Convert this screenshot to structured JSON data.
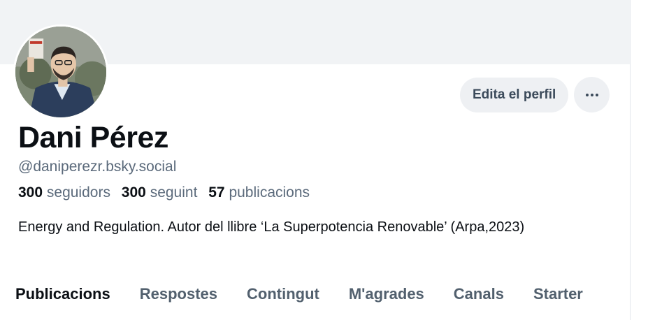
{
  "profile": {
    "name": "Dani Pérez",
    "handle": "@daniperezr.bsky.social",
    "bio": "Energy and Regulation. Autor del llibre ‘La Superpotencia Renovable’ (Arpa,2023)"
  },
  "actions": {
    "edit_label": "Edita el perfil",
    "more_icon": "ellipsis-icon"
  },
  "stats": {
    "followers_count": "300",
    "followers_label": "seguidors",
    "following_count": "300",
    "following_label": "seguint",
    "posts_count": "57",
    "posts_label": "publicacions"
  },
  "tabs": [
    {
      "label": "Publicacions",
      "active": true
    },
    {
      "label": "Respostes",
      "active": false
    },
    {
      "label": "Contingut",
      "active": false
    },
    {
      "label": "M'agrades",
      "active": false
    },
    {
      "label": "Canals",
      "active": false
    },
    {
      "label": "Starter",
      "active": false
    }
  ],
  "colors": {
    "banner": "#f1f3f5",
    "button_bg": "#eef0f3",
    "muted_text": "#5b6a7b",
    "primary_text": "#0b0f14"
  }
}
